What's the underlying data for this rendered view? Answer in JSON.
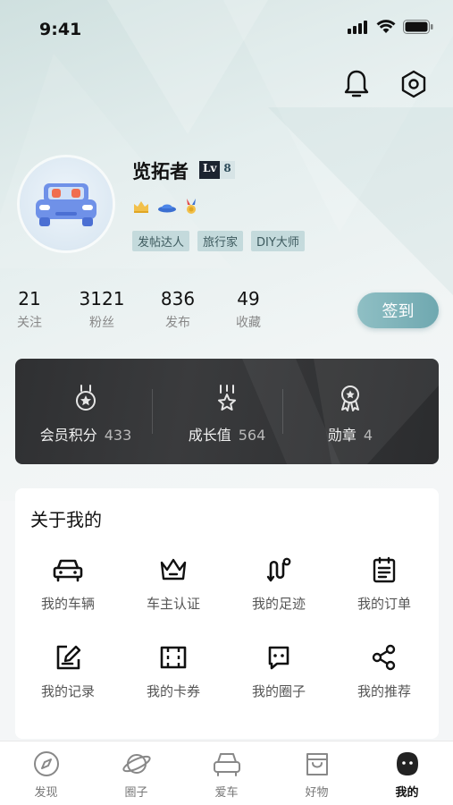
{
  "status_bar": {
    "time": "9:41"
  },
  "profile": {
    "username": "览拓者",
    "level_prefix": "Lv",
    "level": "8",
    "tags": [
      "发帖达人",
      "旅行家",
      "DIY大师"
    ]
  },
  "stats": [
    {
      "value": "21",
      "label": "关注"
    },
    {
      "value": "3121",
      "label": "粉丝"
    },
    {
      "value": "836",
      "label": "发布"
    },
    {
      "value": "49",
      "label": "收藏"
    }
  ],
  "checkin": {
    "label": "签到"
  },
  "member": {
    "points": {
      "label": "会员积分",
      "value": "433"
    },
    "growth": {
      "label": "成长值",
      "value": "564"
    },
    "badges": {
      "label": "勋章",
      "value": "4"
    }
  },
  "about": {
    "title": "关于我的",
    "items": [
      {
        "label": "我的车辆",
        "icon": "car-icon"
      },
      {
        "label": "车主认证",
        "icon": "crown-icon"
      },
      {
        "label": "我的足迹",
        "icon": "route-icon"
      },
      {
        "label": "我的订单",
        "icon": "order-icon"
      },
      {
        "label": "我的记录",
        "icon": "edit-icon"
      },
      {
        "label": "我的卡券",
        "icon": "ticket-icon"
      },
      {
        "label": "我的圈子",
        "icon": "circle-chat-icon"
      },
      {
        "label": "我的推荐",
        "icon": "share-icon"
      }
    ]
  },
  "tabs": [
    {
      "label": "发现",
      "icon": "compass-icon"
    },
    {
      "label": "圈子",
      "icon": "planet-icon"
    },
    {
      "label": "爱车",
      "icon": "car-front-icon"
    },
    {
      "label": "好物",
      "icon": "shopping-bag-icon"
    },
    {
      "label": "我的",
      "icon": "profile-face-icon"
    }
  ],
  "colors": {
    "accent": "#7ab1b8",
    "card_dark": "#2f3032",
    "background": "#f4f6f7"
  }
}
